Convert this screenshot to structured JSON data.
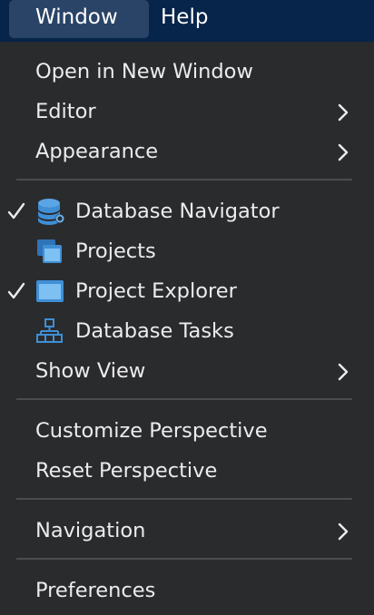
{
  "menubar": {
    "items": [
      {
        "label": "Window"
      },
      {
        "label": "Help"
      }
    ]
  },
  "menu": {
    "items": [
      {
        "label": "Open in New Window"
      },
      {
        "label": "Editor"
      },
      {
        "label": "Appearance"
      },
      {
        "label": "Database Navigator",
        "checked": true,
        "icon": "database-icon"
      },
      {
        "label": "Projects",
        "checked": false,
        "icon": "projects-icon"
      },
      {
        "label": "Project Explorer",
        "checked": true,
        "icon": "project-explorer-icon"
      },
      {
        "label": "Database Tasks",
        "checked": false,
        "icon": "database-tasks-icon"
      },
      {
        "label": "Show View"
      },
      {
        "label": "Customize Perspective"
      },
      {
        "label": "Reset Perspective"
      },
      {
        "label": "Navigation"
      },
      {
        "label": "Preferences"
      }
    ]
  },
  "colors": {
    "menubar_bg": "#07244a",
    "active_menu_bg": "#2a4467",
    "menu_bg": "#2a2b2d",
    "text": "#ececec",
    "icon_blue": "#3f8fd6"
  }
}
